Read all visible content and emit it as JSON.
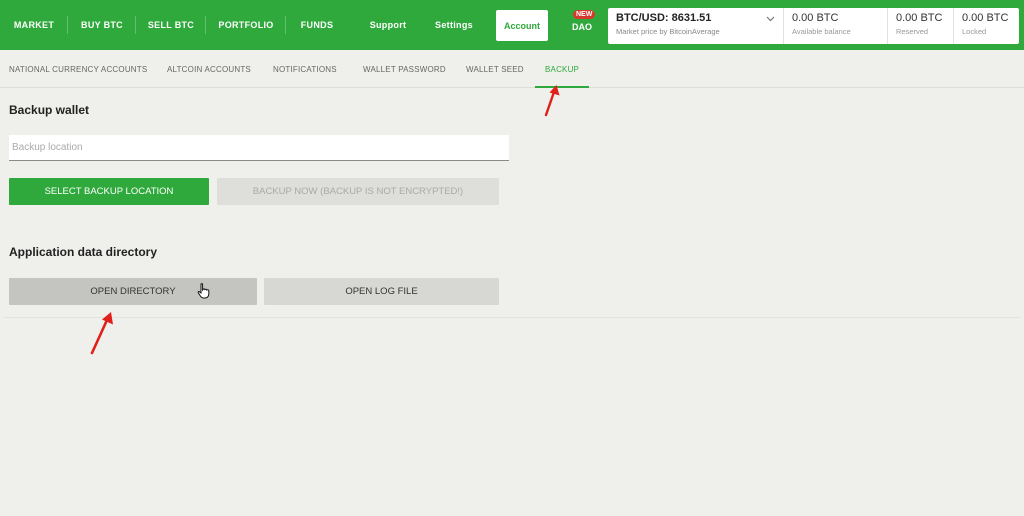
{
  "nav": {
    "main": [
      "MARKET",
      "BUY BTC",
      "SELL BTC",
      "PORTFOLIO",
      "FUNDS"
    ],
    "secondary": [
      "Support",
      "Settings"
    ],
    "account": "Account",
    "dao": {
      "badge": "NEW",
      "label": "DAO"
    }
  },
  "market_price": {
    "pair_price": "BTC/USD: 8631.51",
    "source": "Market price by BitcoinAverage"
  },
  "balances": [
    {
      "amount": "0.00 BTC",
      "label": "Available balance"
    },
    {
      "amount": "0.00 BTC",
      "label": "Reserved"
    },
    {
      "amount": "0.00 BTC",
      "label": "Locked"
    }
  ],
  "subtabs": [
    "NATIONAL CURRENCY ACCOUNTS",
    "ALTCOIN ACCOUNTS",
    "NOTIFICATIONS",
    "WALLET PASSWORD",
    "WALLET SEED",
    "BACKUP"
  ],
  "backup": {
    "title": "Backup wallet",
    "location_placeholder": "Backup location",
    "select_label": "SELECT BACKUP LOCATION",
    "backup_now_label": "BACKUP NOW (BACKUP IS NOT ENCRYPTED!)"
  },
  "app_data": {
    "title": "Application data directory",
    "open_directory_label": "OPEN DIRECTORY",
    "open_log_label": "OPEN LOG FILE"
  },
  "colors": {
    "accent": "#2fa93c",
    "annotation_arrow": "#e0201b",
    "badge": "#d63a2f"
  },
  "icons": [
    "chevron-down-icon",
    "annotation-arrow-icon",
    "hand-cursor-icon"
  ]
}
